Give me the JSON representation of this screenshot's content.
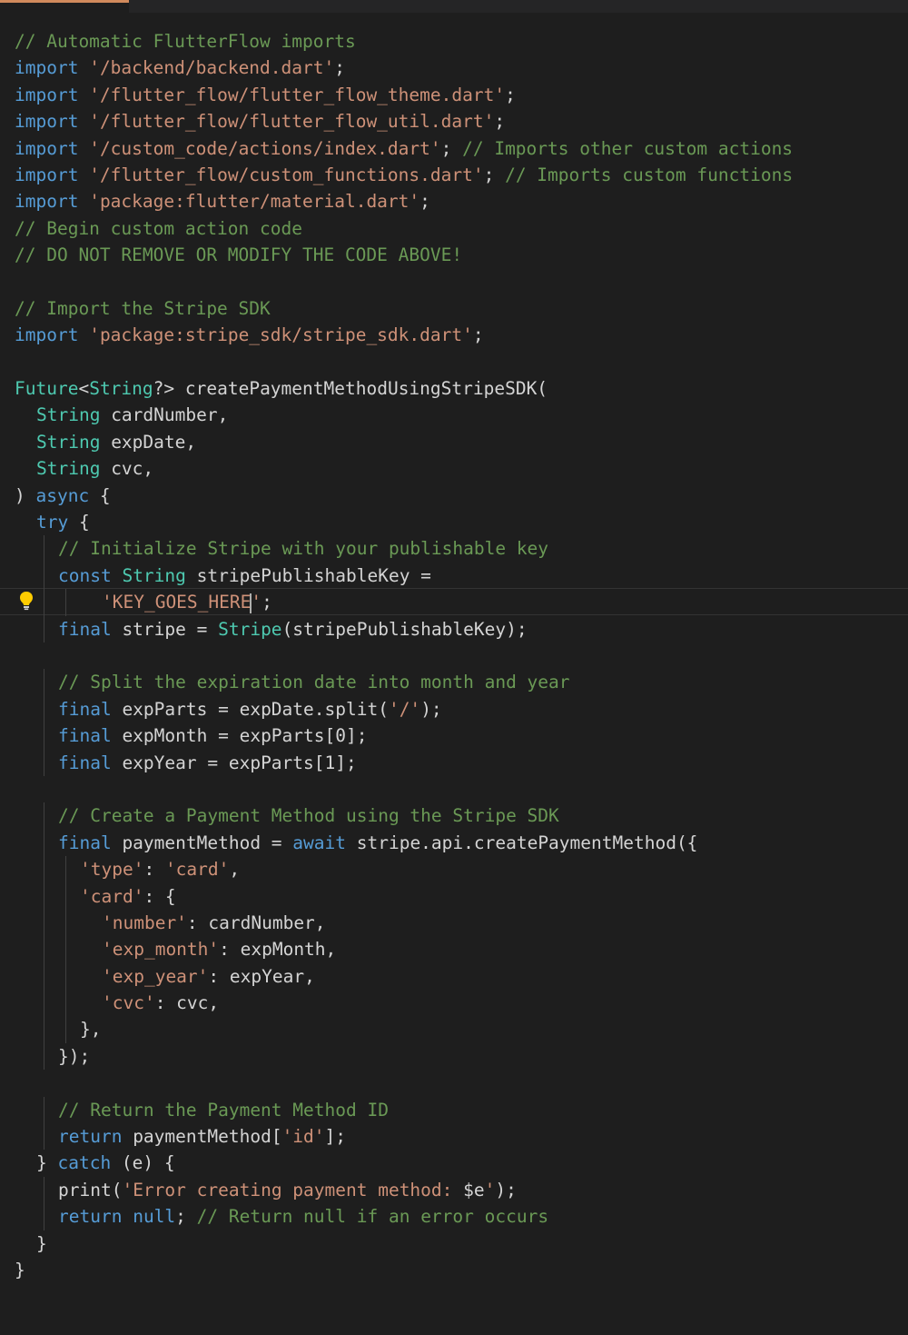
{
  "editor": {
    "lines": [
      {
        "tokens": [
          {
            "t": "// Automatic FlutterFlow imports",
            "c": "comment"
          }
        ]
      },
      {
        "tokens": [
          {
            "t": "import",
            "c": "keyword"
          },
          {
            "t": " ",
            "c": "punct"
          },
          {
            "t": "'/backend/backend.dart'",
            "c": "string"
          },
          {
            "t": ";",
            "c": "punct"
          }
        ]
      },
      {
        "tokens": [
          {
            "t": "import",
            "c": "keyword"
          },
          {
            "t": " ",
            "c": "punct"
          },
          {
            "t": "'/flutter_flow/flutter_flow_theme.dart'",
            "c": "string"
          },
          {
            "t": ";",
            "c": "punct"
          }
        ]
      },
      {
        "tokens": [
          {
            "t": "import",
            "c": "keyword"
          },
          {
            "t": " ",
            "c": "punct"
          },
          {
            "t": "'/flutter_flow/flutter_flow_util.dart'",
            "c": "string"
          },
          {
            "t": ";",
            "c": "punct"
          }
        ]
      },
      {
        "tokens": [
          {
            "t": "import",
            "c": "keyword"
          },
          {
            "t": " ",
            "c": "punct"
          },
          {
            "t": "'/custom_code/actions/index.dart'",
            "c": "string"
          },
          {
            "t": "; ",
            "c": "punct"
          },
          {
            "t": "// Imports other custom actions",
            "c": "comment"
          }
        ]
      },
      {
        "tokens": [
          {
            "t": "import",
            "c": "keyword"
          },
          {
            "t": " ",
            "c": "punct"
          },
          {
            "t": "'/flutter_flow/custom_functions.dart'",
            "c": "string"
          },
          {
            "t": "; ",
            "c": "punct"
          },
          {
            "t": "// Imports custom functions",
            "c": "comment"
          }
        ]
      },
      {
        "tokens": [
          {
            "t": "import",
            "c": "keyword"
          },
          {
            "t": " ",
            "c": "punct"
          },
          {
            "t": "'package:flutter/material.dart'",
            "c": "string"
          },
          {
            "t": ";",
            "c": "punct"
          }
        ]
      },
      {
        "tokens": [
          {
            "t": "// Begin custom action code",
            "c": "comment"
          }
        ]
      },
      {
        "tokens": [
          {
            "t": "// DO NOT REMOVE OR MODIFY THE CODE ABOVE!",
            "c": "comment"
          }
        ]
      },
      {
        "tokens": []
      },
      {
        "tokens": [
          {
            "t": "// Import the Stripe SDK",
            "c": "comment"
          }
        ]
      },
      {
        "tokens": [
          {
            "t": "import",
            "c": "keyword"
          },
          {
            "t": " ",
            "c": "punct"
          },
          {
            "t": "'package:stripe_sdk/stripe_sdk.dart'",
            "c": "string"
          },
          {
            "t": ";",
            "c": "punct"
          }
        ]
      },
      {
        "tokens": []
      },
      {
        "tokens": [
          {
            "t": "Future",
            "c": "type"
          },
          {
            "t": "<",
            "c": "punct"
          },
          {
            "t": "String",
            "c": "type"
          },
          {
            "t": "?> ",
            "c": "punct"
          },
          {
            "t": "createPaymentMethodUsingStripeSDK(",
            "c": "punct"
          }
        ]
      },
      {
        "indent": 1,
        "tokens": [
          {
            "t": "String",
            "c": "type"
          },
          {
            "t": " cardNumber,",
            "c": "punct"
          }
        ]
      },
      {
        "indent": 1,
        "tokens": [
          {
            "t": "String",
            "c": "type"
          },
          {
            "t": " expDate,",
            "c": "punct"
          }
        ]
      },
      {
        "indent": 1,
        "tokens": [
          {
            "t": "String",
            "c": "type"
          },
          {
            "t": " cvc,",
            "c": "punct"
          }
        ]
      },
      {
        "tokens": [
          {
            "t": ") ",
            "c": "punct"
          },
          {
            "t": "async",
            "c": "keyword"
          },
          {
            "t": " {",
            "c": "punct"
          }
        ]
      },
      {
        "indent": 1,
        "tokens": [
          {
            "t": "try",
            "c": "keyword"
          },
          {
            "t": " {",
            "c": "punct"
          }
        ]
      },
      {
        "indent": 2,
        "tokens": [
          {
            "t": "// Initialize Stripe with your publishable key",
            "c": "comment"
          }
        ]
      },
      {
        "indent": 2,
        "tokens": [
          {
            "t": "const",
            "c": "keyword"
          },
          {
            "t": " ",
            "c": "punct"
          },
          {
            "t": "String",
            "c": "type"
          },
          {
            "t": " stripePublishableKey =",
            "c": "punct"
          }
        ]
      },
      {
        "indent": 4,
        "cursor": true,
        "tokens": [
          {
            "t": "'KEY_GOES_HERE",
            "c": "string"
          },
          {
            "t": "|CARET|",
            "c": "caret"
          },
          {
            "t": "'",
            "c": "string"
          },
          {
            "t": ";",
            "c": "punct"
          }
        ]
      },
      {
        "indent": 2,
        "tokens": [
          {
            "t": "final",
            "c": "keyword"
          },
          {
            "t": " stripe = ",
            "c": "punct"
          },
          {
            "t": "Stripe",
            "c": "type"
          },
          {
            "t": "(stripePublishableKey);",
            "c": "punct"
          }
        ]
      },
      {
        "tokens": []
      },
      {
        "indent": 2,
        "tokens": [
          {
            "t": "// Split the expiration date into month and year",
            "c": "comment"
          }
        ]
      },
      {
        "indent": 2,
        "tokens": [
          {
            "t": "final",
            "c": "keyword"
          },
          {
            "t": " expParts = expDate.split(",
            "c": "punct"
          },
          {
            "t": "'/'",
            "c": "string"
          },
          {
            "t": ");",
            "c": "punct"
          }
        ]
      },
      {
        "indent": 2,
        "tokens": [
          {
            "t": "final",
            "c": "keyword"
          },
          {
            "t": " expMonth = expParts[0];",
            "c": "punct"
          }
        ]
      },
      {
        "indent": 2,
        "tokens": [
          {
            "t": "final",
            "c": "keyword"
          },
          {
            "t": " expYear = expParts[1];",
            "c": "punct"
          }
        ]
      },
      {
        "tokens": []
      },
      {
        "indent": 2,
        "tokens": [
          {
            "t": "// Create a Payment Method using the Stripe SDK",
            "c": "comment"
          }
        ]
      },
      {
        "indent": 2,
        "tokens": [
          {
            "t": "final",
            "c": "keyword"
          },
          {
            "t": " paymentMethod = ",
            "c": "punct"
          },
          {
            "t": "await",
            "c": "keyword"
          },
          {
            "t": " stripe.api.createPaymentMethod({",
            "c": "punct"
          }
        ]
      },
      {
        "indent": 3,
        "tokens": [
          {
            "t": "'type'",
            "c": "string"
          },
          {
            "t": ": ",
            "c": "punct"
          },
          {
            "t": "'card'",
            "c": "string"
          },
          {
            "t": ",",
            "c": "punct"
          }
        ]
      },
      {
        "indent": 3,
        "tokens": [
          {
            "t": "'card'",
            "c": "string"
          },
          {
            "t": ": {",
            "c": "punct"
          }
        ]
      },
      {
        "indent": 4,
        "tokens": [
          {
            "t": "'number'",
            "c": "string"
          },
          {
            "t": ": cardNumber,",
            "c": "punct"
          }
        ]
      },
      {
        "indent": 4,
        "tokens": [
          {
            "t": "'exp_month'",
            "c": "string"
          },
          {
            "t": ": expMonth,",
            "c": "punct"
          }
        ]
      },
      {
        "indent": 4,
        "tokens": [
          {
            "t": "'exp_year'",
            "c": "string"
          },
          {
            "t": ": expYear,",
            "c": "punct"
          }
        ]
      },
      {
        "indent": 4,
        "tokens": [
          {
            "t": "'cvc'",
            "c": "string"
          },
          {
            "t": ": cvc,",
            "c": "punct"
          }
        ]
      },
      {
        "indent": 3,
        "tokens": [
          {
            "t": "},",
            "c": "punct"
          }
        ]
      },
      {
        "indent": 2,
        "tokens": [
          {
            "t": "});",
            "c": "punct"
          }
        ]
      },
      {
        "tokens": []
      },
      {
        "indent": 2,
        "tokens": [
          {
            "t": "// Return the Payment Method ID",
            "c": "comment"
          }
        ]
      },
      {
        "indent": 2,
        "tokens": [
          {
            "t": "return",
            "c": "keyword"
          },
          {
            "t": " paymentMethod[",
            "c": "punct"
          },
          {
            "t": "'id'",
            "c": "string"
          },
          {
            "t": "];",
            "c": "punct"
          }
        ]
      },
      {
        "indent": 1,
        "tokens": [
          {
            "t": "} ",
            "c": "punct"
          },
          {
            "t": "catch",
            "c": "keyword"
          },
          {
            "t": " (e) {",
            "c": "punct"
          }
        ]
      },
      {
        "indent": 2,
        "tokens": [
          {
            "t": "print(",
            "c": "punct"
          },
          {
            "t": "'Error creating payment method: ",
            "c": "string"
          },
          {
            "t": "$e",
            "c": "punct"
          },
          {
            "t": "'",
            "c": "string"
          },
          {
            "t": ");",
            "c": "punct"
          }
        ]
      },
      {
        "indent": 2,
        "tokens": [
          {
            "t": "return",
            "c": "keyword"
          },
          {
            "t": " ",
            "c": "punct"
          },
          {
            "t": "null",
            "c": "keyword"
          },
          {
            "t": "; ",
            "c": "punct"
          },
          {
            "t": "// Return null if an error occurs",
            "c": "comment"
          }
        ]
      },
      {
        "indent": 1,
        "tokens": [
          {
            "t": "}",
            "c": "punct"
          }
        ]
      },
      {
        "tokens": [
          {
            "t": "}",
            "c": "punct"
          }
        ]
      }
    ]
  },
  "icons": {
    "lightbulb": "lightbulb-icon"
  },
  "colors": {
    "background": "#1e1e1e",
    "comment": "#6a9955",
    "keyword": "#569cd6",
    "string": "#ce9178",
    "type": "#4ec9b0",
    "text": "#d4d4d4",
    "lightbulb": "#ffcc00"
  }
}
